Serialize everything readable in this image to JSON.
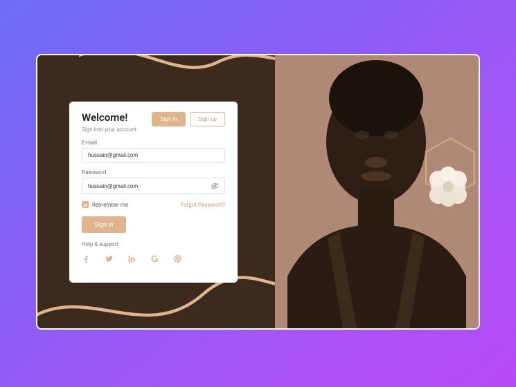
{
  "header": {
    "title": "Welcome!",
    "subtitle": "Sign into your account"
  },
  "tabs": {
    "signin": "Sign in",
    "signup": "Sign up"
  },
  "fields": {
    "email": {
      "label": "E-mail",
      "value": "hussain@gmail.com"
    },
    "password": {
      "label": "Password",
      "value": "hussain@gmail.com"
    }
  },
  "remember": {
    "label": "Remember me"
  },
  "forgot": "Forgot Password?",
  "submit": "Sign in",
  "help": "Help & support",
  "socials": [
    "facebook",
    "twitter",
    "linkedin",
    "google",
    "pinterest"
  ],
  "colors": {
    "accent": "#e0b48c",
    "dark": "#3d2a1e"
  }
}
